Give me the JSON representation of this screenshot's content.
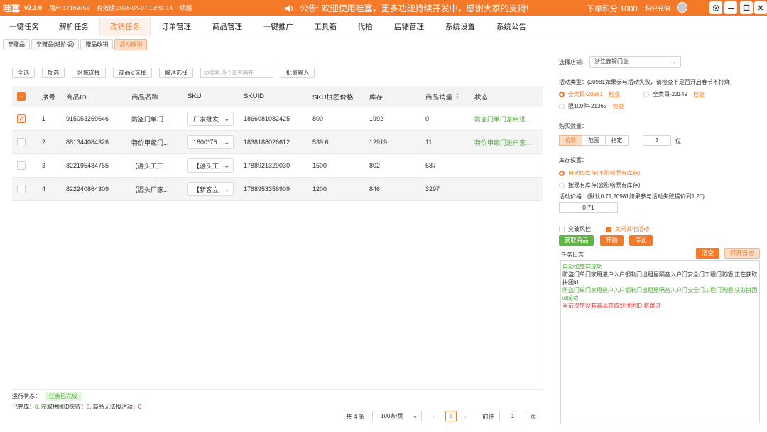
{
  "titlebar": {
    "app_name": "哇塞",
    "version": "v2.1.0",
    "user": "用户:17169755",
    "expire": "有效期:2026-04-07 12:41:14",
    "renew": "续期",
    "notice": "公告: 欢迎使用哇塞，更多功能持续开发中，感谢大家的支持!",
    "points": "下单积分:1000",
    "recharge": "积分充值"
  },
  "menu": [
    "一键任务",
    "解析任务",
    "改销任务",
    "订单管理",
    "商品管理",
    "一键推广",
    "工具箱",
    "代拍",
    "店铺管理",
    "系统设置",
    "系统公告"
  ],
  "subtabs": [
    "非赠品",
    "非赠品(进阶版)",
    "赠品改销",
    "活动改销"
  ],
  "toolbar": {
    "select_all": "全选",
    "invert": "反选",
    "range_select": "区域选择",
    "id_select": "商品id选择",
    "cancel_select": "取消选择",
    "id_search_placeholder": "ID搜索,多个逗号隔开",
    "batch_input": "批量输入"
  },
  "table": {
    "headers": [
      "序号",
      "商品ID",
      "商品名称",
      "SKU",
      "SKUID",
      "SKU拼团价格",
      "库存",
      "商品销量",
      "状态"
    ],
    "rows": [
      {
        "idx": "1",
        "pid": "915053269646",
        "name": "防盗门单门...",
        "sku": "厂家批发",
        "skuid": "1866081082425",
        "price": "800",
        "stock": "1992",
        "sales": "0",
        "status": "防盗门单门家用进...",
        "checked": true
      },
      {
        "idx": "2",
        "pid": "881344084326",
        "name": "特价甲级门...",
        "sku": "1800*76",
        "skuid": "1838188026612",
        "price": "539.6",
        "stock": "12919",
        "sales": "11",
        "status": "特价甲级门进户家...",
        "checked": false
      },
      {
        "idx": "3",
        "pid": "822195434765",
        "name": "【源头工厂...",
        "sku": "【源头工",
        "skuid": "1788921329030",
        "price": "1500",
        "stock": "802",
        "sales": "687",
        "status": "",
        "checked": false
      },
      {
        "idx": "4",
        "pid": "822240864309",
        "name": "【源头厂家...",
        "sku": "【新客立",
        "skuid": "1788953356909",
        "price": "1200",
        "stock": "846",
        "sales": "3297",
        "status": "",
        "checked": false
      }
    ]
  },
  "run_status": {
    "label": "运行状态：",
    "value": "任务已完成"
  },
  "summary": {
    "done_label": "已完成：",
    "done": "0",
    "fail_label": ", 获取拼团ID失败：",
    "fail": "0",
    "cannot_label": ", 商品无法报活动：",
    "cannot": "0"
  },
  "pager": {
    "total": "共 4 条",
    "page_size": "100条/页",
    "current": "1",
    "goto_label": "前往",
    "goto_value": "1",
    "page_unit": "页"
  },
  "right": {
    "shop_label": "选择店铺:",
    "shop_value": "浙江鑫钶门业",
    "activity_type_label": "活动类型：(20981如果参与活动失败，请检查下是否开启春节不打烊)",
    "opt_all_20981": "全类目-20981",
    "opt_all_23149": "全类目-23149",
    "opt_100": "限100件-21365",
    "check": "检查",
    "buy_qty_label": "购买数量：",
    "seg_digits": "位数",
    "seg_range": "范围",
    "seg_fixed": "指定",
    "qty_value": "3",
    "qty_unit": "位",
    "stock_label": "库存设置：",
    "stock_auto": "自动加库存(不影响原有库存)",
    "stock_existing": "按现有库存(会影响原有库存)",
    "price_label": "活动价格：(默认0.71,20981如果参与活动失败提价到1.20)",
    "price_value": "0.71",
    "risk_label": "突破风控",
    "close_group_label": "关闭其他活动",
    "btn_fetch": "获取商品",
    "btn_start": "开始",
    "btn_stop": "停止",
    "log_label": "任务日志",
    "btn_clear": "清空",
    "btn_open_log": "打开日志",
    "logs": [
      {
        "type": "ok",
        "text": "自动加库存成功"
      },
      {
        "type": "norm",
        "text": "防盗门单门家用进户入户钢制门出租屋隔音入户门安全门工程门防晒,正在获取拼团id"
      },
      {
        "type": "ok",
        "text": "防盗门单门家用进户入户钢制门出租屋隔音入户门安全门工程门防晒,获取拼团id成功"
      },
      {
        "type": "err",
        "text": "当前次序没有商品获取到拼团ID,将跳过"
      }
    ]
  },
  "colors": {
    "brand": "#f47a2a",
    "success": "#4cae3a",
    "error": "#e33333"
  }
}
